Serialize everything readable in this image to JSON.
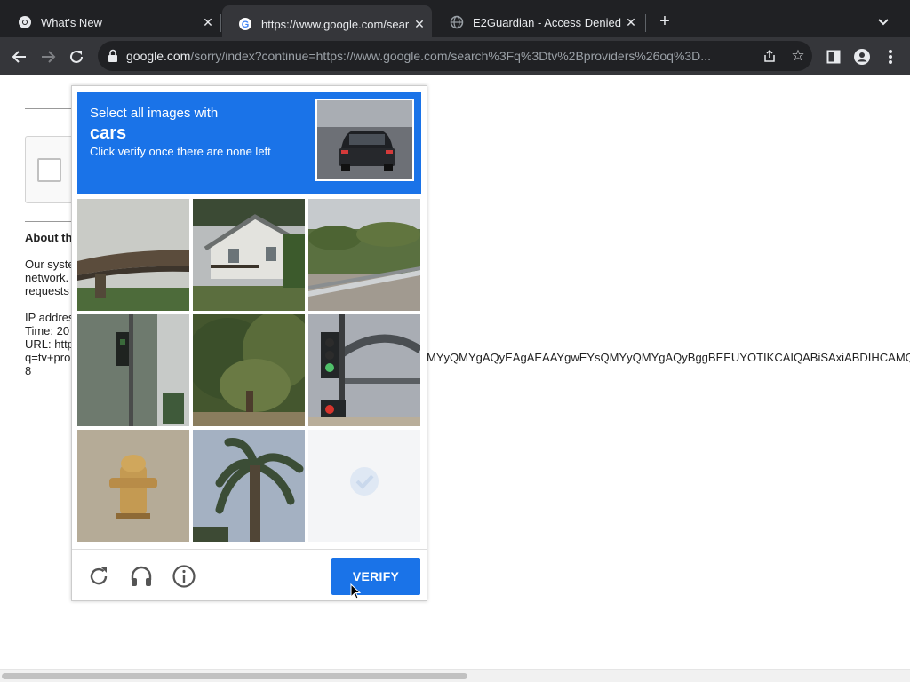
{
  "tabs": [
    {
      "title": "What's New",
      "icon": "chrome-icon",
      "active": false
    },
    {
      "title": "https://www.google.com/sear",
      "icon": "google-icon",
      "active": true
    },
    {
      "title": "E2Guardian - Access Denied",
      "icon": "globe-icon",
      "active": false
    }
  ],
  "omnibox": {
    "domain": "google.com",
    "path": "/sorry/index?continue=https://www.google.com/search%3Fq%3Dtv%2Bproviders%26oq%3D..."
  },
  "page": {
    "about_heading": "About th",
    "lines": [
      "Our syste",
      "network.",
      "requests",
      "IP addres",
      "Time: 20",
      "URL: http",
      "q=tv+pro",
      "8"
    ],
    "query_tail": "MYyQMYgAQyEAgAEAAYgwEYsQMYyQMYgAQyBggBEEUYOTIKCAIQABiSAxiABDIHCAMQ"
  },
  "captcha": {
    "select_text": "Select all images with",
    "target_word": "cars",
    "instruction": "Click verify once there are none left",
    "verify_label": "VERIFY",
    "tiles": [
      {
        "content": "overpass bridge"
      },
      {
        "content": "white house"
      },
      {
        "content": "guardrail and trees"
      },
      {
        "content": "traffic light by building"
      },
      {
        "content": "tree"
      },
      {
        "content": "traffic light"
      },
      {
        "content": "fire hydrant"
      },
      {
        "content": "palm tree"
      },
      {
        "content": "fading tile",
        "selected": true
      }
    ]
  },
  "colors": {
    "accent": "#1a73e8",
    "tabbar": "#202124",
    "toolbar": "#35363a"
  }
}
